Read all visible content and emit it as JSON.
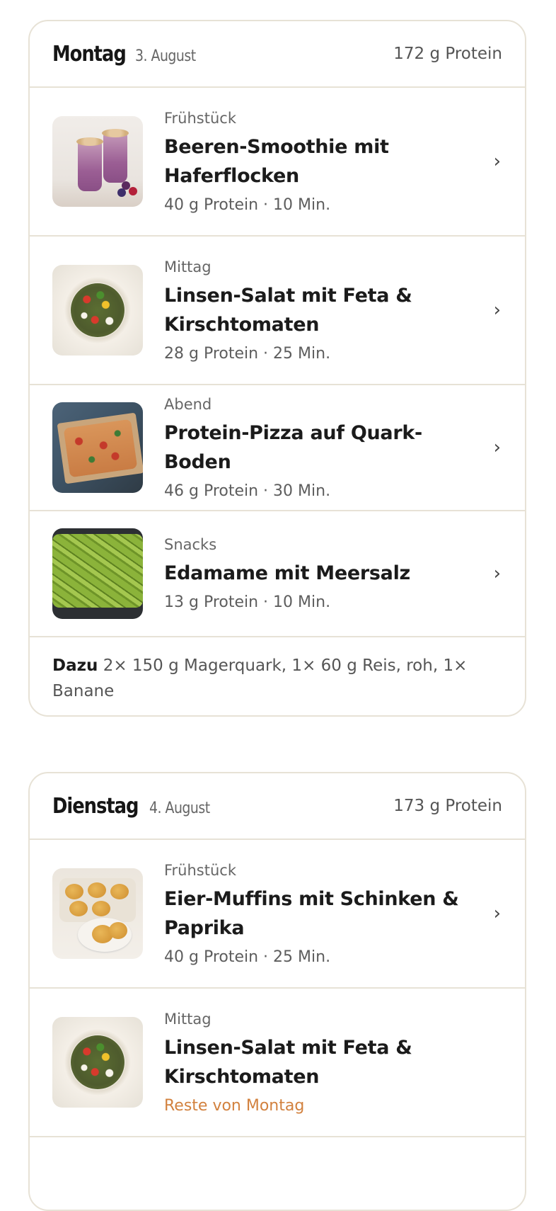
{
  "days": [
    {
      "name": "Montag",
      "date": "3. August",
      "total": "172 g Protein",
      "meals": [
        {
          "type": "Frühstück",
          "title_line1": "Beeren-Smoothie mit",
          "title_line2": "Haferflocken",
          "meta": "40 g Protein · 10 Min.",
          "chevron": "›",
          "image": "berry-smoothie-image"
        },
        {
          "type": "Mittag",
          "title_line1": "Linsen-Salat mit Feta &",
          "title_line2": "Kirschtomaten",
          "meta": "28 g Protein · 25 Min.",
          "chevron": "›",
          "image": "lentil-salad-image"
        },
        {
          "type": "Abend",
          "title_line1": "Protein-Pizza auf Quark-Boden",
          "meta": "46 g Protein · 30 Min.",
          "chevron": "›",
          "image": "protein-pizza-image"
        },
        {
          "type": "Snacks",
          "title_line1": "Edamame mit Meersalz",
          "meta": "13 g Protein · 10 Min.",
          "chevron": "›",
          "image": "edamame-image"
        }
      ],
      "extras_label": "Dazu",
      "extras_text": "2× 150 g Magerquark, 1× 60 g Reis, roh, 1×",
      "extras_text2": "Banane"
    },
    {
      "name": "Dienstag",
      "date": "4. August",
      "total": "173 g Protein",
      "meals": [
        {
          "type": "Frühstück",
          "title_line1": "Eier-Muffins mit Schinken &",
          "title_line2": "Paprika",
          "meta": "40 g Protein · 25 Min.",
          "chevron": "›",
          "image": "egg-muffins-image"
        },
        {
          "type": "Mittag",
          "title_line1": "Linsen-Salat mit Feta &",
          "title_line2": "Kirschtomaten",
          "leftover": "Reste von Montag",
          "image": "lentil-salad-image"
        }
      ]
    }
  ],
  "colors": {
    "border": "#e7e2d6",
    "accent": "#d2813e",
    "text": "#1b1b1b",
    "muted": "#5d5d5d"
  }
}
